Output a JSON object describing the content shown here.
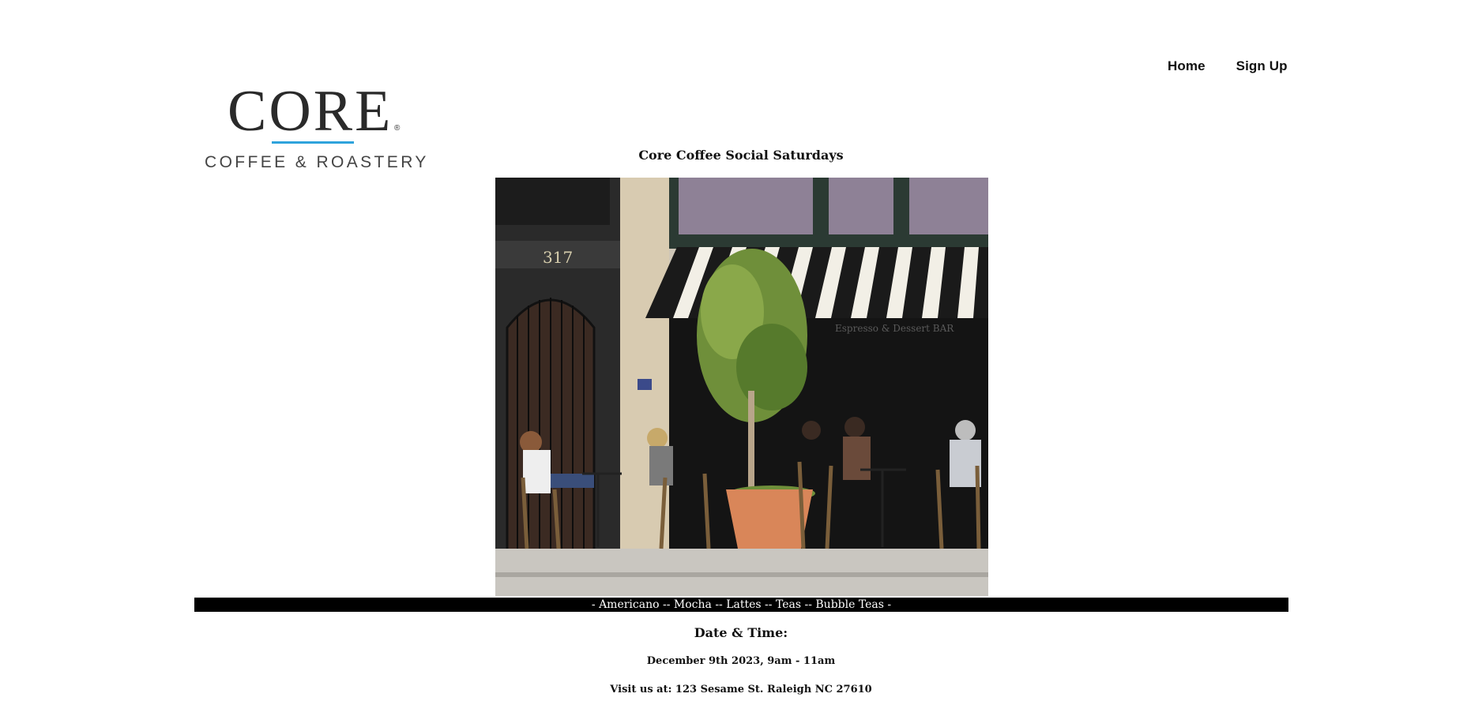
{
  "nav": {
    "home": "Home",
    "signup": "Sign Up"
  },
  "logo": {
    "main": "CORE",
    "reg": "®",
    "sub": "COFFEE & ROASTERY"
  },
  "event": {
    "title": "Core Coffee Social Saturdays",
    "menu": "- Americano -- Mocha -- Lattes -- Teas -- Bubble Teas -",
    "datetime_heading": "Date & Time:",
    "datetime_value": "December 9th 2023, 9am - 11am",
    "visit": "Visit us at: 123 Sesame St. Raleigh NC 27610"
  },
  "photo": {
    "address_number": "317",
    "shop_sign": "Espresso & Dessert BAR"
  },
  "colors": {
    "accent": "#2ea3dc",
    "bar": "#000000",
    "text": "#111111"
  }
}
